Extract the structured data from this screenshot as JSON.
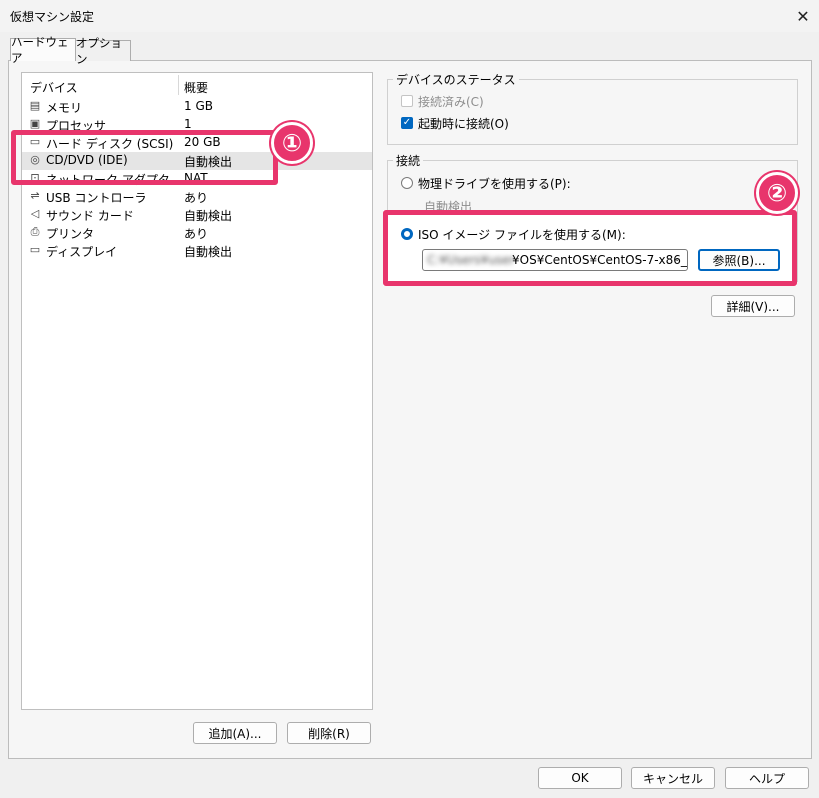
{
  "window": {
    "title": "仮想マシン設定",
    "close_glyph": "✕"
  },
  "tabs": [
    {
      "label": "ハードウェア"
    },
    {
      "label": "オプション"
    }
  ],
  "device_list": {
    "col_device": "デバイス",
    "col_summary": "概要",
    "rows": [
      {
        "icon": "memory-icon",
        "glyph": "▤",
        "name": "メモリ",
        "summary": "1 GB"
      },
      {
        "icon": "processor-icon",
        "glyph": "▣",
        "name": "プロセッサ",
        "summary": "1"
      },
      {
        "icon": "hard-disk-icon",
        "glyph": "▭",
        "name": "ハード ディスク (SCSI)",
        "summary": "20 GB"
      },
      {
        "icon": "cd-dvd-icon",
        "glyph": "◎",
        "name": "CD/DVD (IDE)",
        "summary": "自動検出"
      },
      {
        "icon": "network-adapter-icon",
        "glyph": "⊡",
        "name": "ネットワーク アダプタ",
        "summary": "NAT"
      },
      {
        "icon": "usb-icon",
        "glyph": "⇌",
        "name": "USB コントローラ",
        "summary": "あり"
      },
      {
        "icon": "sound-card-icon",
        "glyph": "◁",
        "name": "サウンド カード",
        "summary": "自動検出"
      },
      {
        "icon": "printer-icon",
        "glyph": "⎙",
        "name": "プリンタ",
        "summary": "あり"
      },
      {
        "icon": "display-icon",
        "glyph": "▭",
        "name": "ディスプレイ",
        "summary": "自動検出"
      }
    ],
    "add_label": "追加(A)...",
    "remove_label": "削除(R)"
  },
  "device_status": {
    "title": "デバイスのステータス",
    "connected_label": "接続済み(C)",
    "connected_checked": false,
    "power_on_label": "起動時に接続(O)",
    "power_on_checked": true
  },
  "connection": {
    "title": "接続",
    "physical_label": "物理ドライブを使用する(P):",
    "physical_selected": false,
    "auto_detect_label": "自動検出",
    "iso_label": "ISO イメージ ファイルを使用する(M):",
    "iso_selected": true,
    "iso_path_hidden": "C:¥Users¥user",
    "iso_path_visible": "¥OS¥CentOS¥CentOS-7-x86_",
    "browse_label": "参照(B)...",
    "advanced_label": "詳細(V)..."
  },
  "annotations": {
    "badge1": "①",
    "badge2": "②",
    "accent_color": "#e8356c"
  },
  "footer": {
    "ok_label": "OK",
    "cancel_label": "キャンセル",
    "help_label": "ヘルプ"
  }
}
